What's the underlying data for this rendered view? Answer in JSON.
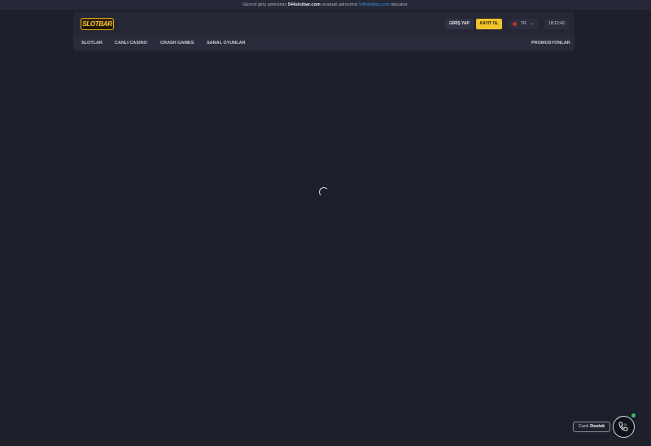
{
  "topbar": {
    "prefix": "Güncel giriş adresimiz",
    "current_domain": "544slotbar.com",
    "middle": "sıradaki adresimiz",
    "next_domain": "545slotbar.com",
    "suffix": "olacaktır."
  },
  "header": {
    "logo_text": "SLOTBAR",
    "login_label": "GİRİŞ YAP",
    "register_label": "KAYIT OL",
    "language": "TR",
    "clock": "18:12:42"
  },
  "nav": {
    "items": [
      {
        "label": "SLOTLAR"
      },
      {
        "label": "CANLI CASINO"
      },
      {
        "label": "CRASH GAMES"
      },
      {
        "label": "SANAL OYUNLAR"
      }
    ],
    "promotions_label": "PROMOSYONLAR"
  },
  "support": {
    "prefix": "Canlı",
    "label": "Destek",
    "icon": "phone-24-7-icon"
  },
  "colors": {
    "background": "#1d1f2b",
    "accent": "#f2c42c",
    "link": "#3a8ee8"
  }
}
